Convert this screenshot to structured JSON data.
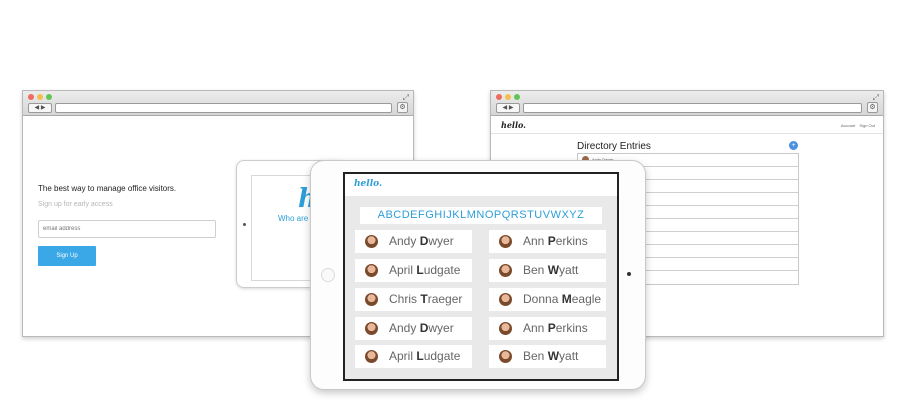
{
  "colors": {
    "accent": "#2d9ed8",
    "signup_button": "#3aa8e6",
    "close": "#ed6b5f",
    "minimize": "#f5bf4f",
    "zoom": "#62c655"
  },
  "signup_page": {
    "headline": "The best way to manage office visitors.",
    "subheadline": "Sign up for early access",
    "email_placeholder": "email address",
    "button_label": "Sign Up"
  },
  "back_tablet": {
    "logo": "h",
    "tagline": "Who are y"
  },
  "directory_page": {
    "logo": "hello.",
    "nav": [
      "Account",
      "Sign Out"
    ],
    "title": "Directory Entries",
    "first_entry": "Andy Dwyer",
    "add_icon": "plus-circle-icon"
  },
  "tablet": {
    "logo": "hello.",
    "alphabet": "ABCDEFGHIJKLMNOPQRSTUVWXYZ",
    "left_column": [
      {
        "first": "Andy",
        "initial": "D",
        "rest": "wyer"
      },
      {
        "first": "April",
        "initial": "L",
        "rest": "udgate"
      },
      {
        "first": "Chris",
        "initial": "T",
        "rest": "raeger"
      },
      {
        "first": "Andy",
        "initial": "D",
        "rest": "wyer"
      },
      {
        "first": "April",
        "initial": "L",
        "rest": "udgate"
      }
    ],
    "right_column": [
      {
        "first": "Ann",
        "initial": "P",
        "rest": "erkins"
      },
      {
        "first": "Ben",
        "initial": "W",
        "rest": "yatt"
      },
      {
        "first": "Donna",
        "initial": "M",
        "rest": "eagle"
      },
      {
        "first": "Ann",
        "initial": "P",
        "rest": "erkins"
      },
      {
        "first": "Ben",
        "initial": "W",
        "rest": "yatt"
      }
    ]
  }
}
